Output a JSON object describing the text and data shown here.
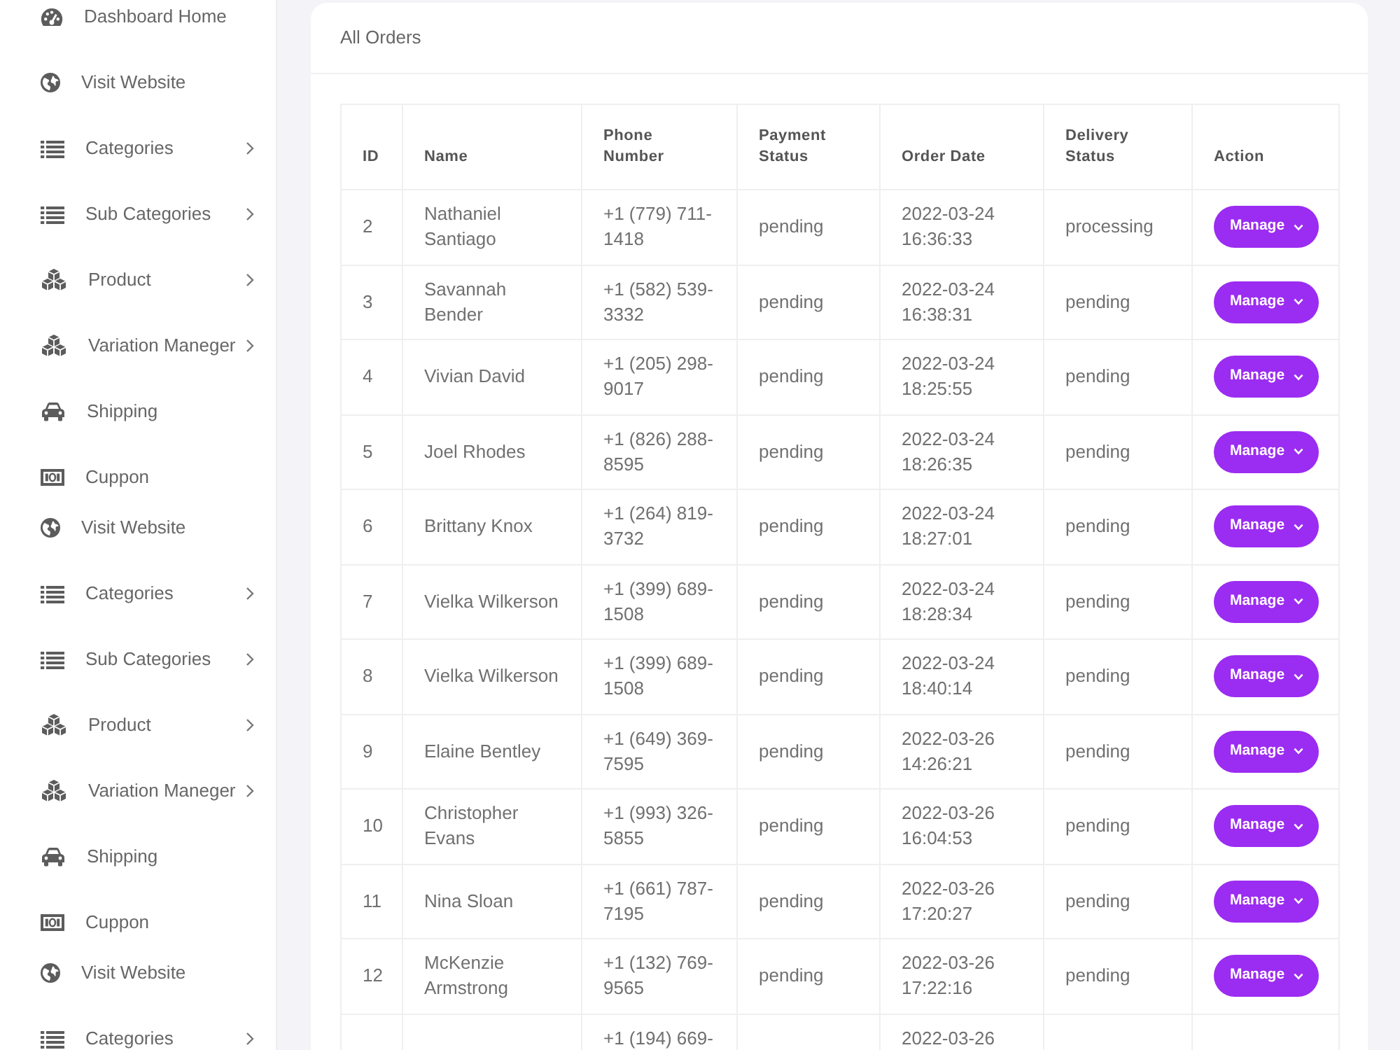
{
  "sidebar": {
    "groups": [
      {
        "items": [
          {
            "label": "Dashboard Home",
            "kind": "dashboard"
          },
          {
            "label": "Visit Website",
            "kind": "website"
          },
          {
            "label": "Categories",
            "kind": "categories",
            "expanded": false
          },
          {
            "label": "Sub Categories",
            "kind": "subcategories",
            "expanded": false
          },
          {
            "label": "Product",
            "kind": "product",
            "expanded": false
          },
          {
            "label": "Variation Maneger",
            "kind": "variation",
            "expanded": false
          },
          {
            "label": "Shipping",
            "kind": "shipping"
          },
          {
            "label": "Cuppon",
            "kind": "coupon"
          }
        ]
      },
      {
        "items": [
          {
            "label": "Visit Website",
            "kind": "website"
          },
          {
            "label": "Categories",
            "kind": "categories",
            "expanded": false
          },
          {
            "label": "Sub Categories",
            "kind": "subcategories",
            "expanded": false
          },
          {
            "label": "Product",
            "kind": "product",
            "expanded": false
          },
          {
            "label": "Variation Maneger",
            "kind": "variation",
            "expanded": false
          },
          {
            "label": "Shipping",
            "kind": "shipping"
          },
          {
            "label": "Cuppon",
            "kind": "coupon"
          }
        ]
      },
      {
        "items": [
          {
            "label": "Visit Website",
            "kind": "website"
          },
          {
            "label": "Categories",
            "kind": "categories",
            "expanded": false
          }
        ]
      }
    ]
  },
  "orders": {
    "title": "All Orders",
    "columns": [
      "ID",
      "Name",
      "Phone Number",
      "Payment Status",
      "Order Date",
      "Delivery Status",
      "Action"
    ],
    "rows": [
      {
        "id": "2",
        "name": "Nathaniel Santiago",
        "phone": "+1 (779) 711-1418",
        "payment_status": "pending",
        "order_date": "2022-03-24 16:36:33",
        "delivery_status": "processing",
        "action": "Manage"
      },
      {
        "id": "3",
        "name": "Savannah Bender",
        "phone": "+1 (582) 539-3332",
        "payment_status": "pending",
        "order_date": "2022-03-24 16:38:31",
        "delivery_status": "pending",
        "action": "Manage"
      },
      {
        "id": "4",
        "name": "Vivian David",
        "phone": "+1 (205) 298-9017",
        "payment_status": "pending",
        "order_date": "2022-03-24 18:25:55",
        "delivery_status": "pending",
        "action": "Manage"
      },
      {
        "id": "5",
        "name": "Joel Rhodes",
        "phone": "+1 (826) 288-8595",
        "payment_status": "pending",
        "order_date": "2022-03-24 18:26:35",
        "delivery_status": "pending",
        "action": "Manage"
      },
      {
        "id": "6",
        "name": "Brittany Knox",
        "phone": "+1 (264) 819-3732",
        "payment_status": "pending",
        "order_date": "2022-03-24 18:27:01",
        "delivery_status": "pending",
        "action": "Manage"
      },
      {
        "id": "7",
        "name": "Vielka Wilkerson",
        "phone": "+1 (399) 689-1508",
        "payment_status": "pending",
        "order_date": "2022-03-24 18:28:34",
        "delivery_status": "pending",
        "action": "Manage"
      },
      {
        "id": "8",
        "name": "Vielka Wilkerson",
        "phone": "+1 (399) 689-1508",
        "payment_status": "pending",
        "order_date": "2022-03-24 18:40:14",
        "delivery_status": "pending",
        "action": "Manage"
      },
      {
        "id": "9",
        "name": "Elaine Bentley",
        "phone": "+1 (649) 369-7595",
        "payment_status": "pending",
        "order_date": "2022-03-26 14:26:21",
        "delivery_status": "pending",
        "action": "Manage"
      },
      {
        "id": "10",
        "name": "Christopher Evans",
        "phone": "+1 (993) 326-5855",
        "payment_status": "pending",
        "order_date": "2022-03-26 16:04:53",
        "delivery_status": "pending",
        "action": "Manage"
      },
      {
        "id": "11",
        "name": "Nina Sloan",
        "phone": "+1 (661) 787-7195",
        "payment_status": "pending",
        "order_date": "2022-03-26 17:20:27",
        "delivery_status": "pending",
        "action": "Manage"
      },
      {
        "id": "12",
        "name": "McKenzie Armstrong",
        "phone": "+1 (132) 769-9565",
        "payment_status": "pending",
        "order_date": "2022-03-26 17:22:16",
        "delivery_status": "pending",
        "action": "Manage"
      },
      {
        "phone": "+1 (194) 669-",
        "order_date": "2022-03-26"
      }
    ]
  }
}
